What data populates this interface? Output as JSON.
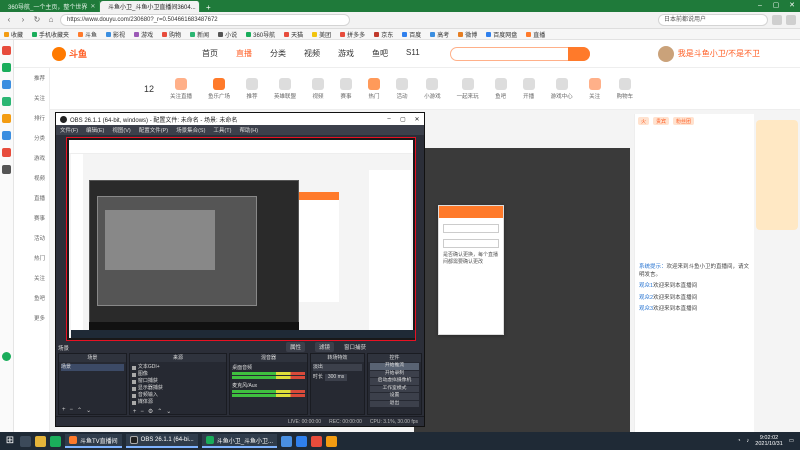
{
  "browser": {
    "tabs": [
      {
        "label": "360导航_一个主页，整个世界",
        "active": false
      },
      {
        "label": "斗鱼小卫_斗鱼小卫直播间3604...",
        "active": true
      }
    ],
    "new_tab": "+",
    "url": "https://www.douyu.com/230680?_r=0.504661683487672",
    "search_placeholder": "日本前都说用户",
    "bookmarks": [
      "收藏",
      "手机收藏夹",
      "斗鱼",
      "影视",
      "游戏",
      "购物",
      "新闻",
      "小说",
      "360导航",
      "天猫",
      "美团",
      "拼多多",
      "京东",
      "百度",
      "高考",
      "微博",
      "百度网盘",
      "直播"
    ]
  },
  "douyu": {
    "logo": "斗鱼",
    "nav": [
      "首页",
      "直播",
      "分类",
      "视频",
      "游戏",
      "鱼吧",
      "S11"
    ],
    "username": "我是斗鱼小卫/不是不卫",
    "follow_count": "12",
    "subnav": [
      "关注直播",
      "鱼乐广场",
      "推荐",
      "英雄联盟",
      "视频",
      "赛事",
      "热门",
      "活动",
      "小游戏",
      "一起来玩",
      "鱼吧",
      "开播",
      "游戏中心",
      "关注",
      "购物车"
    ],
    "leftnav": [
      "推荐",
      "关注",
      "排行",
      "分类",
      "游戏",
      "视频",
      "直播",
      "赛事",
      "活动",
      "热门",
      "关注",
      "鱼吧",
      "更多"
    ],
    "danmu_tabs": [
      "火",
      "贵宾",
      "粉丝团"
    ],
    "chat": [
      {
        "nick": "系统提示：",
        "text": "欢迎来到斗鱼小卫的直播间，请文明发言。"
      },
      {
        "nick": "观众1",
        "text": "欢迎来到本直播间"
      },
      {
        "nick": "观众2",
        "text": "欢迎来到本直播间"
      },
      {
        "nick": "观众3",
        "text": "欢迎来到本直播间"
      }
    ],
    "dialog_text": "是否确认更换，每个直播间都需要确认更改"
  },
  "obs": {
    "title": "OBS 26.1.1 (64-bit, windows) - 配置文件: 未命名 - 场景: 未命名",
    "menu": [
      "文件(F)",
      "编辑(E)",
      "视图(V)",
      "配置文件(P)",
      "场景集合(S)",
      "工具(T)",
      "帮助(H)"
    ],
    "scene_label": "场景",
    "controls": [
      "属性",
      "滤镜",
      "窗口捕获"
    ],
    "docks": {
      "scenes": {
        "title": "场景",
        "items": [
          "场景"
        ]
      },
      "sources": {
        "title": "来源",
        "items": [
          "文本GDI+",
          "图像",
          "窗口捕获",
          "显示器捕获",
          "音频输入",
          "媒体源"
        ]
      },
      "mixer": {
        "title": "混音器",
        "tracks": [
          "桌面音频",
          "麦克风/Aux"
        ]
      },
      "transitions": {
        "title": "转场特效",
        "type": "淡出",
        "duration_label": "时长",
        "duration": "300 ms"
      },
      "controls": {
        "title": "控件",
        "buttons": [
          "开始推流",
          "开始录制",
          "启动虚拟摄像机",
          "工作室模式",
          "设置",
          "退出"
        ]
      }
    },
    "status": [
      "LIVE: 00:00:00",
      "REC: 00:00:00",
      "CPU: 3.1%, 30.00 fps"
    ]
  },
  "taskbar": {
    "apps": [
      "斗鱼TV直播间",
      "OBS 26.1.1 (64-bi...",
      "斗鱼小卫_斗鱼小卫..."
    ],
    "time": "9:02:02",
    "date": "2021/10/31"
  }
}
